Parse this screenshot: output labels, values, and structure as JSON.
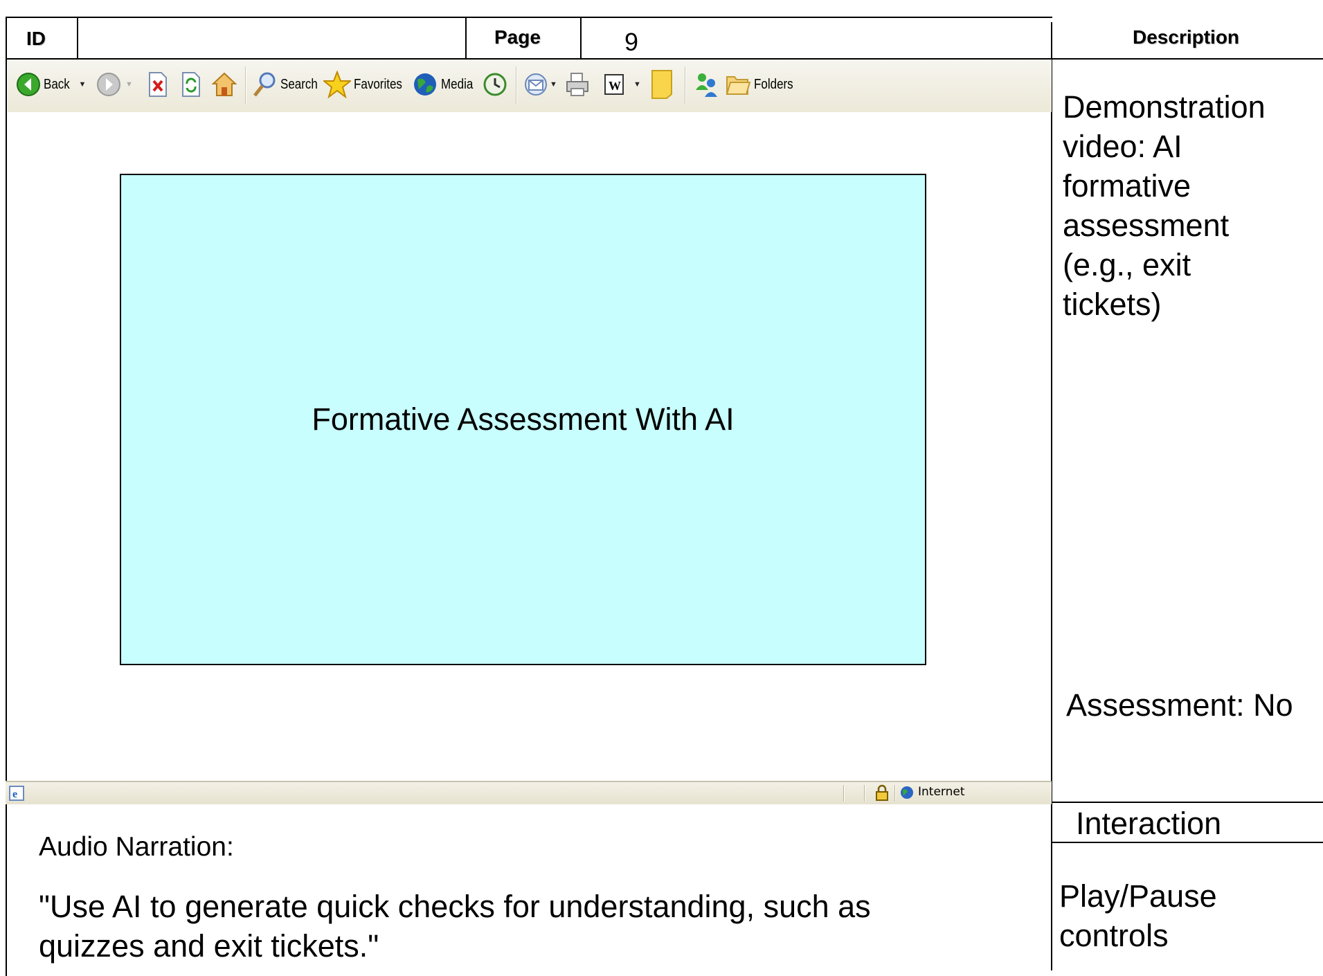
{
  "header": {
    "id_label": "ID",
    "id_value": "",
    "page_label": "Page",
    "page_value": "9",
    "description_label": "Description"
  },
  "browser": {
    "toolbar": {
      "back_label": "Back",
      "search_label": "Search",
      "favorites_label": "Favorites",
      "media_label": "Media",
      "folders_label": "Folders"
    },
    "statusbar": {
      "zone_label": "Internet"
    }
  },
  "slide": {
    "title": "Formative Assessment With AI",
    "background": "#c8fefe"
  },
  "description": {
    "text": "Demonstration video: AI formative assessment (e.g., exit tickets)",
    "assessment": "Assessment: No"
  },
  "narration": {
    "label": "Audio Narration:",
    "text": "\"Use AI to generate quick checks for understanding, such as quizzes and exit tickets.\""
  },
  "interaction": {
    "label": "Interaction",
    "value": "Play/Pause controls"
  }
}
